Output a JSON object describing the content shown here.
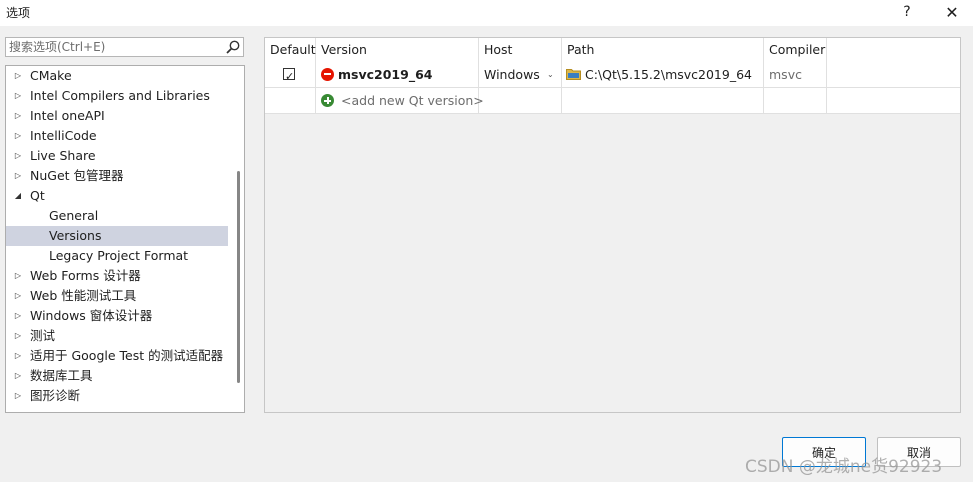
{
  "window": {
    "title": "选项",
    "help_label": "?",
    "close_label": "✕"
  },
  "search": {
    "placeholder": "搜索选项(Ctrl+E)"
  },
  "tree": {
    "items": [
      {
        "label": "CMake",
        "expanded": false
      },
      {
        "label": "Intel Compilers and Libraries",
        "expanded": false
      },
      {
        "label": "Intel oneAPI",
        "expanded": false
      },
      {
        "label": "IntelliCode",
        "expanded": false
      },
      {
        "label": "Live Share",
        "expanded": false
      },
      {
        "label": "NuGet 包管理器",
        "expanded": false
      },
      {
        "label": "Qt",
        "expanded": true
      },
      {
        "label": "General"
      },
      {
        "label": "Versions",
        "selected": true
      },
      {
        "label": "Legacy Project Format"
      },
      {
        "label": "Web Forms 设计器",
        "expanded": false
      },
      {
        "label": "Web 性能测试工具",
        "expanded": false
      },
      {
        "label": "Windows 窗体设计器",
        "expanded": false
      },
      {
        "label": "测试",
        "expanded": false
      },
      {
        "label": "适用于 Google Test 的测试适配器",
        "expanded": false
      },
      {
        "label": "数据库工具",
        "expanded": false
      },
      {
        "label": "图形诊断",
        "expanded": false
      }
    ]
  },
  "table": {
    "headers": {
      "default": "Default",
      "version": "Version",
      "host": "Host",
      "path": "Path",
      "compiler": "Compiler"
    },
    "rows": [
      {
        "default_checked": true,
        "version": "msvc2019_64",
        "host": "Windows",
        "path": "C:\\Qt\\5.15.2\\msvc2019_64",
        "compiler": "msvc"
      }
    ],
    "add_row_label": "<add new Qt version>"
  },
  "buttons": {
    "ok": "确定",
    "cancel": "取消"
  },
  "watermark": "CSDN @龙城ne货92923",
  "colors": {
    "selection": "#cfd3e0",
    "error_icon": "#e51400",
    "add_icon": "#388a34",
    "ok_border": "#0078d4"
  }
}
